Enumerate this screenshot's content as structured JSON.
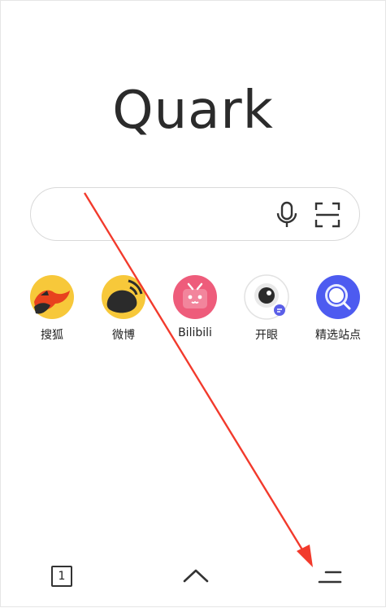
{
  "app": {
    "logo_text": "Quark"
  },
  "search": {
    "placeholder": "",
    "value": "",
    "mic_icon": "microphone-icon",
    "scan_icon": "scan-icon"
  },
  "sites": [
    {
      "label": "搜狐",
      "icon": "sohu-fox-icon",
      "color": "#F5C518"
    },
    {
      "label": "微博",
      "icon": "weibo-icon",
      "color": "#F5C518"
    },
    {
      "label": "Bilibili",
      "icon": "bilibili-tv-icon",
      "color": "#EE5C7B"
    },
    {
      "label": "开眼",
      "icon": "eye-icon",
      "color": "#ffffff"
    },
    {
      "label": "精选站点",
      "icon": "featured-sites-icon",
      "color": "#4D5BF0"
    }
  ],
  "bottom_bar": {
    "tab_count": "1",
    "tabs_icon": "tabs-icon",
    "up_icon": "chevron-up-icon",
    "menu_icon": "menu-icon"
  },
  "annotation": {
    "color": "#F23A2C"
  }
}
